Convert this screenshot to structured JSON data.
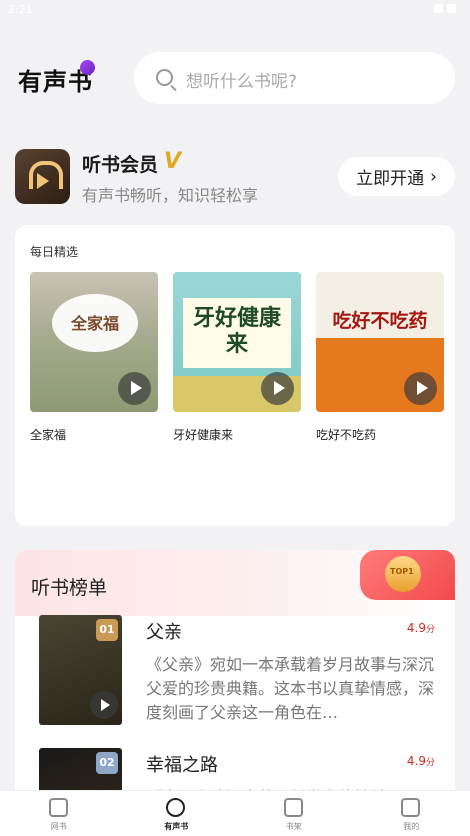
{
  "status_bar": {
    "time": "2:21"
  },
  "header": {
    "title": "有声书",
    "search_placeholder": "想听什么书呢?"
  },
  "vip": {
    "title": "听书会员",
    "badge": "V",
    "subtitle": "有声书畅听，知识轻松享",
    "button_label": "立即开通",
    "button_chevron": "›"
  },
  "daily": {
    "title": "每日精选",
    "items": [
      {
        "name": "全家福",
        "cover_text": "全家福"
      },
      {
        "name": "牙好健康来",
        "cover_text": "牙好健康来"
      },
      {
        "name": "吃好不吃药",
        "cover_text": "吃好不吃药"
      }
    ]
  },
  "ranking": {
    "title": "听书榜单",
    "trophy_label": "TOP1",
    "items": [
      {
        "rank": "01",
        "name": "父亲",
        "score": "4.9",
        "score_unit": "分",
        "desc": "《父亲》宛如一本承载着岁月故事与深沉父爱的珍贵典籍。这本书以真挚情感，深度刻画了父亲这一角色在…"
      },
      {
        "rank": "02",
        "name": "幸福之路",
        "score": "4.9",
        "score_unit": "分",
        "desc": "《幸福之路》由英国哲学家伯特兰…"
      }
    ]
  },
  "tabbar": {
    "tabs": [
      {
        "label": "网书",
        "icon": "book-icon"
      },
      {
        "label": "有声书",
        "icon": "audio-disc-icon",
        "active": true
      },
      {
        "label": "书架",
        "icon": "bookshelf-icon"
      },
      {
        "label": "我的",
        "icon": "profile-icon"
      }
    ]
  }
}
